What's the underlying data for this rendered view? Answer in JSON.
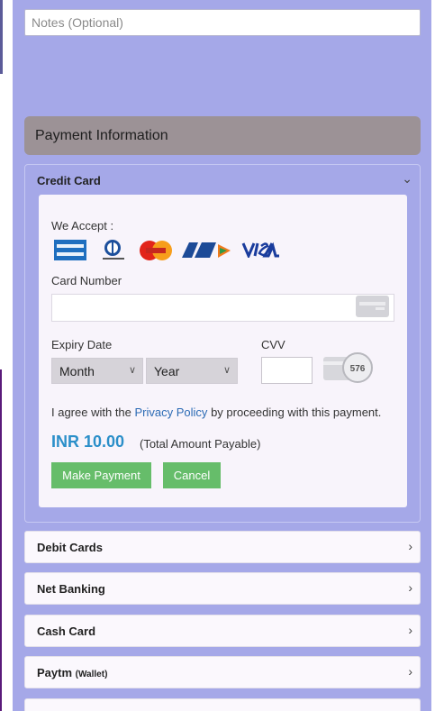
{
  "notes": {
    "placeholder": "Notes (Optional)"
  },
  "payment_header": "Payment Information",
  "credit_card": {
    "title": "Credit Card",
    "we_accept": "We Accept :",
    "logos": [
      "American Express",
      "Diners Club",
      "MasterCard",
      "RuPay",
      "VISA"
    ],
    "card_number_label": "Card Number",
    "expiry_label": "Expiry Date",
    "month_select": "Month",
    "year_select": "Year",
    "cvv_label": "CVV",
    "cvv_hint": "576",
    "policy_prefix": "I agree with the",
    "policy_link": "Privacy Policy",
    "policy_suffix": "by proceeding with this payment.",
    "amount": "INR 10.00",
    "amount_note": "(Total Amount Payable)",
    "make_payment": "Make Payment",
    "cancel": "Cancel"
  },
  "methods": [
    {
      "label": "Debit Cards"
    },
    {
      "label": "Net Banking"
    },
    {
      "label": "Cash Card"
    },
    {
      "label": "Paytm",
      "sub": "(Wallet)"
    }
  ],
  "colors": {
    "panel": "#a5a8e8",
    "header": "#9c9296",
    "button": "#66bd6a",
    "amount": "#2b8fc9",
    "link": "#2c6bb5"
  }
}
